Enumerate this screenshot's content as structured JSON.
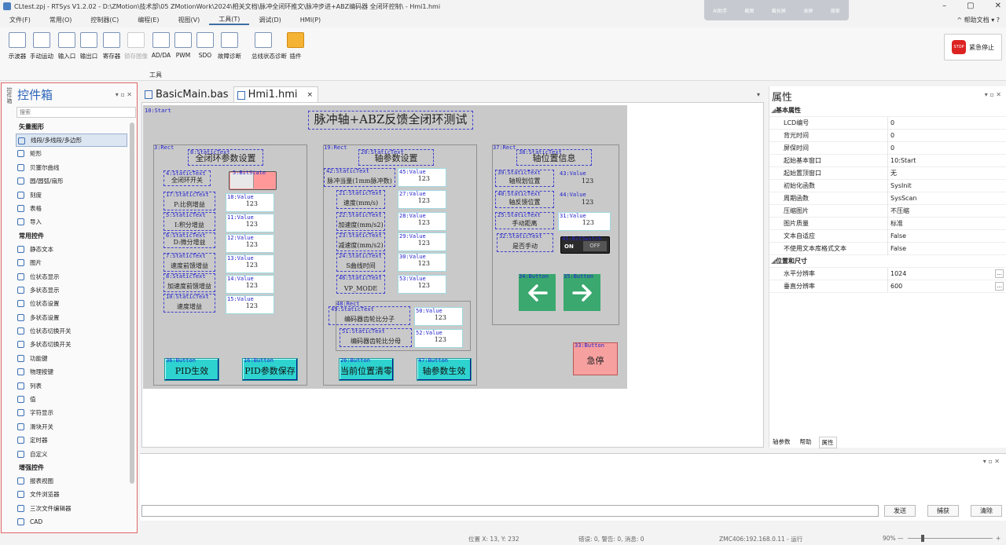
{
  "window": {
    "title": "CLtest.zpj - RTSys V1.2.02 - D:\\ZMotion\\技术部\\05 ZMotionWork\\2024\\相关文档\\脉冲全闭环推文\\脉冲步进+ABZ编码器 全闭环控制\\ - Hmi1.hmi",
    "controls": [
      "–",
      "▢",
      "✕"
    ],
    "floatbar": [
      "AI助手",
      "截图",
      "截长屏",
      "录屏",
      "搜索"
    ]
  },
  "menu": {
    "items": [
      "文件(F)",
      "常用(O)",
      "控制器(C)",
      "编程(E)",
      "视图(V)",
      "工具(T)",
      "调试(D)",
      "HMI(P)"
    ],
    "help": "^ 帮助文档 ▾ ?"
  },
  "ribbon": {
    "tools": [
      {
        "label": "示波器",
        "disabled": false
      },
      {
        "label": "手动运动",
        "disabled": false
      },
      {
        "label": "输入口",
        "disabled": false
      },
      {
        "label": "输出口",
        "disabled": false
      },
      {
        "label": "寄存器",
        "disabled": false
      },
      {
        "label": "锁存图像",
        "disabled": true
      },
      {
        "label": "AD/DA",
        "disabled": false
      },
      {
        "label": "PWM",
        "disabled": false
      },
      {
        "label": "SDO",
        "disabled": false
      },
      {
        "label": "故障诊断",
        "disabled": false
      },
      {
        "label": "总线状态诊断",
        "disabled": false
      },
      {
        "label": "插件",
        "disabled": false
      }
    ],
    "group_label": "工具",
    "estop_label": "紧急停止",
    "estop_icon": "STOP"
  },
  "toolbox": {
    "vtab": "控件箱",
    "title": "控件箱",
    "controls": "▾ ▫ ✕",
    "search_placeholder": "搜索",
    "sections": [
      {
        "title": "矢量图形",
        "items": [
          "线段/多线段/多边形",
          "矩形",
          "贝塞尔曲线",
          "圆/圆弧/扇形",
          "刻度",
          "表格",
          "导入"
        ]
      },
      {
        "title": "常用控件",
        "items": [
          "静态文本",
          "图片",
          "位状态显示",
          "多状态显示",
          "位状态设置",
          "多状态设置",
          "位状态切换开关",
          "多状态切换开关",
          "功能键",
          "物理按键",
          "列表",
          "值",
          "字符显示",
          "滑块开关",
          "定时器",
          "自定义"
        ]
      },
      {
        "title": "增强控件",
        "items": [
          "报表视图",
          "文件浏览器",
          "三次文件编辑器",
          "CAD"
        ]
      }
    ]
  },
  "tabs": [
    {
      "label": "BasicMain.bas",
      "active": false
    },
    {
      "label": "Hmi1.hmi",
      "active": true
    }
  ],
  "hmi": {
    "start": "10:Start",
    "title": "脉冲轴+ABZ反馈全闭环测试",
    "panel1": {
      "rect": "3:Rect",
      "head_tag": "8:StaticText",
      "head": "全闭环参数设置",
      "switch_tag": "4:StaticText",
      "switch_label": "全闭环开关",
      "bit_tag": "5:BitState",
      "rows": [
        {
          "tag": "17:StaticText",
          "label": "P:比例增益",
          "vtag": "18:Value",
          "v": "123"
        },
        {
          "tag": "5:StaticText",
          "label": "I:积分增益",
          "vtag": "11:Value",
          "v": "123"
        },
        {
          "tag": "6:StaticText",
          "label": "D:微分增益",
          "vtag": "12:Value",
          "v": "123"
        },
        {
          "tag": "7:StaticText",
          "label": "速度前馈增益",
          "vtag": "13:Value",
          "v": "123"
        },
        {
          "tag": "8:StaticText",
          "label": "加速度前馈增益",
          "vtag": "14:Value",
          "v": "123"
        },
        {
          "tag": "10:StaticText",
          "label": "速度增益",
          "vtag": "15:Value",
          "v": "123"
        }
      ],
      "btn1_tag": "36:Button",
      "btn1": "PID生效",
      "btn2_tag": "16:Button",
      "btn2": "PID参数保存"
    },
    "panel2": {
      "rect": "19:Rect",
      "head_tag": "20:StaticText",
      "head": "轴参数设置",
      "rows": [
        {
          "tag": "42:StaticText",
          "label": "脉冲当量(1mm脉冲数)",
          "vtag": "45:Value",
          "v": "123"
        },
        {
          "tag": "21:StaticText",
          "label": "速度(mm/s)",
          "vtag": "27:Value",
          "v": "123"
        },
        {
          "tag": "22:StaticText",
          "label": "加速度(mm/s2)",
          "vtag": "28:Value",
          "v": "123"
        },
        {
          "tag": "23:StaticText",
          "label": "减速度(mm/s2)",
          "vtag": "29:Value",
          "v": "123"
        },
        {
          "tag": "24:StaticText",
          "label": "S曲线时间",
          "vtag": "30:Value",
          "v": "123"
        },
        {
          "tag": "46:StaticText",
          "label": "VP_MODE",
          "vtag": "53:Value",
          "v": "123"
        }
      ],
      "sub_rect": "48:Rect",
      "sub_rows": [
        {
          "tag": "49:StaticText",
          "label": "编码器齿轮比分子",
          "vtag": "50:Value",
          "v": "123"
        },
        {
          "tag": "51:StaticText",
          "label": "编码器齿轮比分母",
          "vtag": "52:Value",
          "v": "123"
        }
      ],
      "btn1_tag": "26:Button",
      "btn1": "当前位置清零",
      "btn2_tag": "47:Button",
      "btn2": "轴参数生效"
    },
    "panel3": {
      "rect": "37:Rect",
      "head_tag": "38:StaticText",
      "head": "轴位置信息",
      "rows": [
        {
          "tag": "39:StaticText",
          "label": "轴规划位置",
          "vtag": "43:Value",
          "v": "123"
        },
        {
          "tag": "40:StaticText",
          "label": "轴反馈位置",
          "vtag": "44:Value",
          "v": "123"
        },
        {
          "tag": "25:StaticText",
          "label": "手动距离",
          "vtag": "31:Value",
          "v": "123"
        }
      ],
      "manual_tag": "32:StaticText",
      "manual_label": "是否手动",
      "toggle_tag": "41:BitSwitch",
      "toggle_on": "ON",
      "toggle_off": "OFF",
      "left_tag": "34:Button",
      "right_tag": "35:Button"
    },
    "stop_tag": "33:Button",
    "stop": "急停"
  },
  "properties": {
    "title": "属性",
    "controls": "▾ ▫ ✕",
    "sections": [
      {
        "title": "基本属性",
        "rows": [
          [
            "LCD编号",
            "0"
          ],
          [
            "背光时间",
            "0"
          ],
          [
            "屏保时间",
            "0"
          ],
          [
            "起始基本窗口",
            "10:Start"
          ],
          [
            "起始置顶窗口",
            "无"
          ],
          [
            "初始化函数",
            "SysInit"
          ],
          [
            "周期函数",
            "SysScan"
          ],
          [
            "压缩图片",
            "不压缩"
          ],
          [
            "图片质量",
            "标准"
          ],
          [
            "文本自适应",
            "False"
          ],
          [
            "不使用文本库格式文本",
            "False"
          ]
        ]
      },
      {
        "title": "位置和尺寸",
        "rows": [
          [
            "水平分辨率",
            "1024"
          ],
          [
            "垂直分辨率",
            "600"
          ]
        ]
      }
    ],
    "tabs": [
      "轴参数",
      "帮助",
      "属性"
    ]
  },
  "output": {
    "controls": "▾ ▫ ✕",
    "buttons": [
      "发送",
      "捕获",
      "清除"
    ]
  },
  "status": {
    "pos": "位置 X: 13, Y: 232",
    "errors": "错误: 0, 警告: 0, 消息: 0",
    "conn": "ZMC406:192.168.0.11 - 运行",
    "zoom": "90%",
    "minus": "—",
    "plus": "+"
  }
}
